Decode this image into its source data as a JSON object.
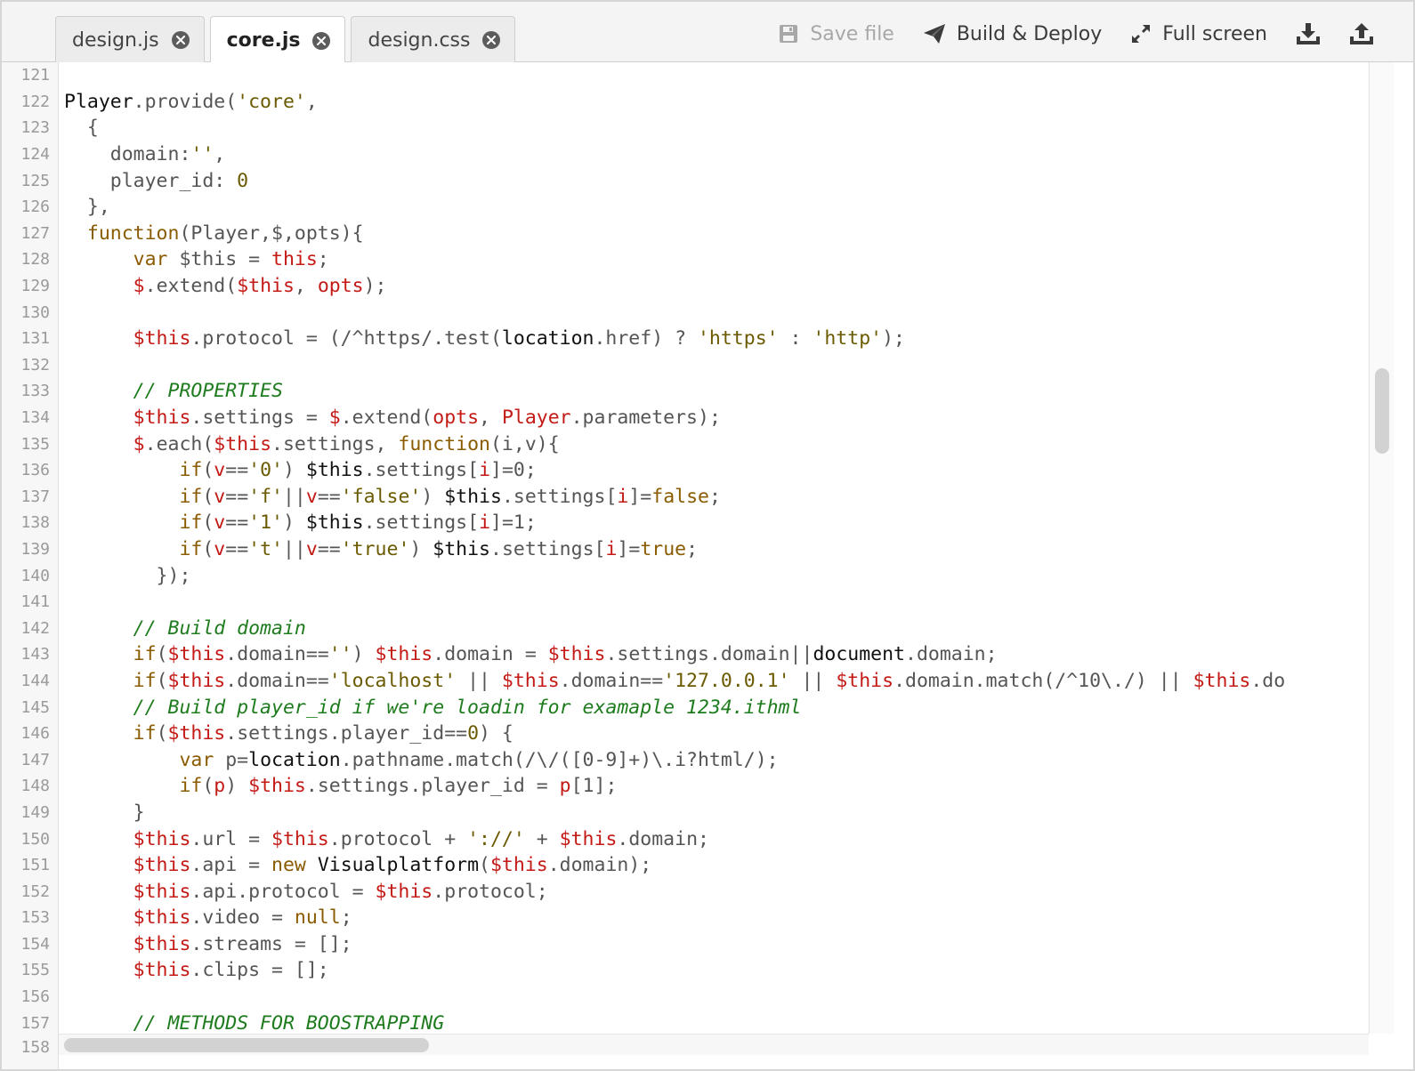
{
  "tabs": [
    {
      "label": "design.js",
      "active": false
    },
    {
      "label": "core.js",
      "active": true
    },
    {
      "label": "design.css",
      "active": false
    }
  ],
  "toolbar": {
    "save_label": "Save file",
    "build_label": "Build & Deploy",
    "fullscreen_label": "Full screen",
    "icons": [
      "save-icon",
      "paper-plane-icon",
      "expand-icon",
      "download-icon",
      "upload-icon"
    ]
  },
  "editor": {
    "language": "javascript",
    "last_visible_line_number": "158",
    "lines": [
      {
        "n": "121",
        "tokens": []
      },
      {
        "n": "122",
        "tokens": [
          [
            "glob",
            "Player"
          ],
          [
            "plain",
            ".provide("
          ],
          [
            "str",
            "'core'"
          ],
          [
            "plain",
            ","
          ]
        ]
      },
      {
        "n": "123",
        "tokens": [
          [
            "plain",
            "  {"
          ]
        ]
      },
      {
        "n": "124",
        "tokens": [
          [
            "plain",
            "    domain:"
          ],
          [
            "str",
            "''"
          ],
          [
            "plain",
            ","
          ]
        ]
      },
      {
        "n": "125",
        "tokens": [
          [
            "plain",
            "    player_id: "
          ],
          [
            "num",
            "0"
          ]
        ]
      },
      {
        "n": "126",
        "tokens": [
          [
            "plain",
            "  },"
          ]
        ]
      },
      {
        "n": "127",
        "tokens": [
          [
            "plain",
            "  "
          ],
          [
            "kw",
            "function"
          ],
          [
            "plain",
            "(Player,$,opts){"
          ]
        ]
      },
      {
        "n": "128",
        "tokens": [
          [
            "plain",
            "      "
          ],
          [
            "kw",
            "var"
          ],
          [
            "plain",
            " $this = "
          ],
          [
            "var",
            "this"
          ],
          [
            "plain",
            ";"
          ]
        ]
      },
      {
        "n": "129",
        "tokens": [
          [
            "plain",
            "      "
          ],
          [
            "var",
            "$"
          ],
          [
            "plain",
            ".extend("
          ],
          [
            "var",
            "$this"
          ],
          [
            "plain",
            ", "
          ],
          [
            "var",
            "opts"
          ],
          [
            "plain",
            ");"
          ]
        ]
      },
      {
        "n": "130",
        "tokens": []
      },
      {
        "n": "131",
        "tokens": [
          [
            "plain",
            "      "
          ],
          [
            "var",
            "$this"
          ],
          [
            "plain",
            ".protocol = (/^https/.test("
          ],
          [
            "glob",
            "location"
          ],
          [
            "plain",
            ".href) ? "
          ],
          [
            "str",
            "'https'"
          ],
          [
            "plain",
            " : "
          ],
          [
            "str",
            "'http'"
          ],
          [
            "plain",
            ");"
          ]
        ]
      },
      {
        "n": "132",
        "tokens": []
      },
      {
        "n": "133",
        "tokens": [
          [
            "plain",
            "      "
          ],
          [
            "com",
            "// PROPERTIES"
          ]
        ]
      },
      {
        "n": "134",
        "tokens": [
          [
            "plain",
            "      "
          ],
          [
            "var",
            "$this"
          ],
          [
            "plain",
            ".settings = "
          ],
          [
            "var",
            "$"
          ],
          [
            "plain",
            ".extend("
          ],
          [
            "var",
            "opts"
          ],
          [
            "plain",
            ", "
          ],
          [
            "var",
            "Player"
          ],
          [
            "plain",
            ".parameters);"
          ]
        ]
      },
      {
        "n": "135",
        "tokens": [
          [
            "plain",
            "      "
          ],
          [
            "var",
            "$"
          ],
          [
            "plain",
            ".each("
          ],
          [
            "var",
            "$this"
          ],
          [
            "plain",
            ".settings, "
          ],
          [
            "kw",
            "function"
          ],
          [
            "plain",
            "(i,v){"
          ]
        ]
      },
      {
        "n": "136",
        "tokens": [
          [
            "plain",
            "          "
          ],
          [
            "kw",
            "if"
          ],
          [
            "plain",
            "("
          ],
          [
            "var",
            "v"
          ],
          [
            "plain",
            "=="
          ],
          [
            "str",
            "'0'"
          ],
          [
            "plain",
            ") "
          ],
          [
            "glob",
            "$this"
          ],
          [
            "plain",
            ".settings["
          ],
          [
            "var",
            "i"
          ],
          [
            "plain",
            "]=0;"
          ]
        ]
      },
      {
        "n": "137",
        "tokens": [
          [
            "plain",
            "          "
          ],
          [
            "kw",
            "if"
          ],
          [
            "plain",
            "("
          ],
          [
            "var",
            "v"
          ],
          [
            "plain",
            "=="
          ],
          [
            "str",
            "'f'"
          ],
          [
            "plain",
            "||"
          ],
          [
            "var",
            "v"
          ],
          [
            "plain",
            "=="
          ],
          [
            "str",
            "'false'"
          ],
          [
            "plain",
            ") "
          ],
          [
            "glob",
            "$this"
          ],
          [
            "plain",
            ".settings["
          ],
          [
            "var",
            "i"
          ],
          [
            "plain",
            "]="
          ],
          [
            "kw",
            "false"
          ],
          [
            "plain",
            ";"
          ]
        ]
      },
      {
        "n": "138",
        "tokens": [
          [
            "plain",
            "          "
          ],
          [
            "kw",
            "if"
          ],
          [
            "plain",
            "("
          ],
          [
            "var",
            "v"
          ],
          [
            "plain",
            "=="
          ],
          [
            "str",
            "'1'"
          ],
          [
            "plain",
            ") "
          ],
          [
            "glob",
            "$this"
          ],
          [
            "plain",
            ".settings["
          ],
          [
            "var",
            "i"
          ],
          [
            "plain",
            "]=1;"
          ]
        ]
      },
      {
        "n": "139",
        "tokens": [
          [
            "plain",
            "          "
          ],
          [
            "kw",
            "if"
          ],
          [
            "plain",
            "("
          ],
          [
            "var",
            "v"
          ],
          [
            "plain",
            "=="
          ],
          [
            "str",
            "'t'"
          ],
          [
            "plain",
            "||"
          ],
          [
            "var",
            "v"
          ],
          [
            "plain",
            "=="
          ],
          [
            "str",
            "'true'"
          ],
          [
            "plain",
            ") "
          ],
          [
            "glob",
            "$this"
          ],
          [
            "plain",
            ".settings["
          ],
          [
            "var",
            "i"
          ],
          [
            "plain",
            "]="
          ],
          [
            "kw",
            "true"
          ],
          [
            "plain",
            ";"
          ]
        ]
      },
      {
        "n": "140",
        "tokens": [
          [
            "plain",
            "        });"
          ]
        ]
      },
      {
        "n": "141",
        "tokens": []
      },
      {
        "n": "142",
        "tokens": [
          [
            "plain",
            "      "
          ],
          [
            "com",
            "// Build domain"
          ]
        ]
      },
      {
        "n": "143",
        "tokens": [
          [
            "plain",
            "      "
          ],
          [
            "kw",
            "if"
          ],
          [
            "plain",
            "("
          ],
          [
            "var",
            "$this"
          ],
          [
            "plain",
            ".domain=="
          ],
          [
            "str",
            "''"
          ],
          [
            "plain",
            ") "
          ],
          [
            "var",
            "$this"
          ],
          [
            "plain",
            ".domain = "
          ],
          [
            "var",
            "$this"
          ],
          [
            "plain",
            ".settings.domain||"
          ],
          [
            "glob",
            "document"
          ],
          [
            "plain",
            ".domain;"
          ]
        ]
      },
      {
        "n": "144",
        "tokens": [
          [
            "plain",
            "      "
          ],
          [
            "kw",
            "if"
          ],
          [
            "plain",
            "("
          ],
          [
            "var",
            "$this"
          ],
          [
            "plain",
            ".domain=="
          ],
          [
            "str",
            "'localhost'"
          ],
          [
            "plain",
            " || "
          ],
          [
            "var",
            "$this"
          ],
          [
            "plain",
            ".domain=="
          ],
          [
            "str",
            "'127.0.0.1'"
          ],
          [
            "plain",
            " || "
          ],
          [
            "var",
            "$this"
          ],
          [
            "plain",
            ".domain.match(/^10\\./) || "
          ],
          [
            "var",
            "$this"
          ],
          [
            "plain",
            ".do"
          ]
        ]
      },
      {
        "n": "145",
        "tokens": [
          [
            "plain",
            "      "
          ],
          [
            "com",
            "// Build player_id if we're loadin for examaple 1234.ithml"
          ]
        ]
      },
      {
        "n": "146",
        "tokens": [
          [
            "plain",
            "      "
          ],
          [
            "kw",
            "if"
          ],
          [
            "plain",
            "("
          ],
          [
            "var",
            "$this"
          ],
          [
            "plain",
            ".settings.player_id=="
          ],
          [
            "num",
            "0"
          ],
          [
            "plain",
            ") {"
          ]
        ]
      },
      {
        "n": "147",
        "tokens": [
          [
            "plain",
            "          "
          ],
          [
            "kw",
            "var"
          ],
          [
            "plain",
            " p="
          ],
          [
            "glob",
            "location"
          ],
          [
            "plain",
            ".pathname.match(/\\/([0-9]+)\\.i?html/);"
          ]
        ]
      },
      {
        "n": "148",
        "tokens": [
          [
            "plain",
            "          "
          ],
          [
            "kw",
            "if"
          ],
          [
            "plain",
            "("
          ],
          [
            "var",
            "p"
          ],
          [
            "plain",
            ") "
          ],
          [
            "var",
            "$this"
          ],
          [
            "plain",
            ".settings.player_id = "
          ],
          [
            "var",
            "p"
          ],
          [
            "plain",
            "[1];"
          ]
        ]
      },
      {
        "n": "149",
        "tokens": [
          [
            "plain",
            "      }"
          ]
        ]
      },
      {
        "n": "150",
        "tokens": [
          [
            "plain",
            "      "
          ],
          [
            "var",
            "$this"
          ],
          [
            "plain",
            ".url = "
          ],
          [
            "var",
            "$this"
          ],
          [
            "plain",
            ".protocol + "
          ],
          [
            "str",
            "'://'"
          ],
          [
            "plain",
            " + "
          ],
          [
            "var",
            "$this"
          ],
          [
            "plain",
            ".domain;"
          ]
        ]
      },
      {
        "n": "151",
        "tokens": [
          [
            "plain",
            "      "
          ],
          [
            "var",
            "$this"
          ],
          [
            "plain",
            ".api = "
          ],
          [
            "kw",
            "new"
          ],
          [
            "plain",
            " "
          ],
          [
            "glob",
            "Visualplatform"
          ],
          [
            "plain",
            "("
          ],
          [
            "var",
            "$this"
          ],
          [
            "plain",
            ".domain);"
          ]
        ]
      },
      {
        "n": "152",
        "tokens": [
          [
            "plain",
            "      "
          ],
          [
            "var",
            "$this"
          ],
          [
            "plain",
            ".api.protocol = "
          ],
          [
            "var",
            "$this"
          ],
          [
            "plain",
            ".protocol;"
          ]
        ]
      },
      {
        "n": "153",
        "tokens": [
          [
            "plain",
            "      "
          ],
          [
            "var",
            "$this"
          ],
          [
            "plain",
            ".video = "
          ],
          [
            "kw",
            "null"
          ],
          [
            "plain",
            ";"
          ]
        ]
      },
      {
        "n": "154",
        "tokens": [
          [
            "plain",
            "      "
          ],
          [
            "var",
            "$this"
          ],
          [
            "plain",
            ".streams = [];"
          ]
        ]
      },
      {
        "n": "155",
        "tokens": [
          [
            "plain",
            "      "
          ],
          [
            "var",
            "$this"
          ],
          [
            "plain",
            ".clips = [];"
          ]
        ]
      },
      {
        "n": "156",
        "tokens": []
      },
      {
        "n": "157",
        "tokens": [
          [
            "plain",
            "      "
          ],
          [
            "com",
            "// METHODS FOR BOOSTRAPPING"
          ]
        ]
      }
    ]
  },
  "colors": {
    "keyword": "#8a5b00",
    "variable": "#c41a16",
    "string": "#6b5a00",
    "comment": "#1e7b1e",
    "plain": "#555555",
    "global": "#111111"
  }
}
